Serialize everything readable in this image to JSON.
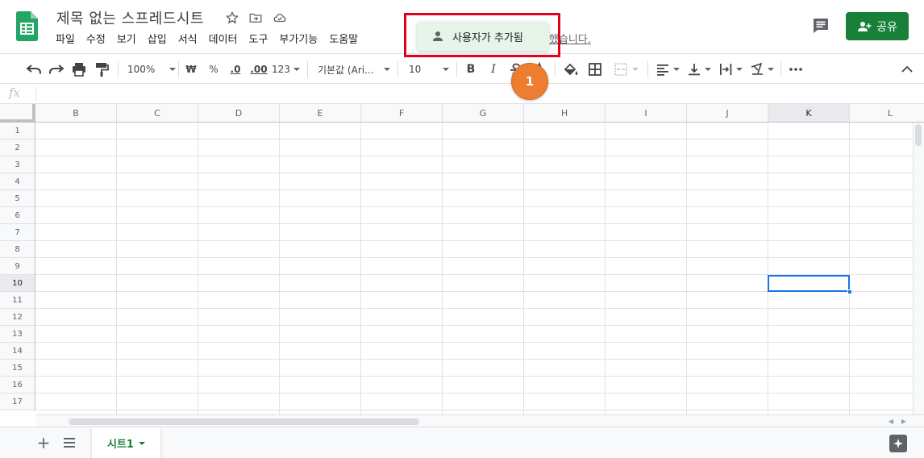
{
  "header": {
    "title": "제목 없는 스프레드시트",
    "menu": [
      "파일",
      "수정",
      "보기",
      "삽입",
      "서식",
      "데이터",
      "도구",
      "부가기능",
      "도움말"
    ],
    "last_edit": "했습니다.",
    "share_label": "공유"
  },
  "toast": {
    "label": "사용자가 추가됨",
    "step_number": "1"
  },
  "toolbar": {
    "zoom": "100%",
    "currency": "₩",
    "percent": "%",
    "decimal_decrease": ".0",
    "decimal_increase": ".00",
    "more_formats": "123",
    "font": "기본값 (Ari...",
    "font_size": "10",
    "bold": "B",
    "italic": "I"
  },
  "formula_bar": {
    "fx_label": "fx"
  },
  "grid": {
    "columns": [
      "B",
      "C",
      "D",
      "E",
      "F",
      "G",
      "H",
      "I",
      "J",
      "K",
      "L"
    ],
    "rows": [
      "1",
      "2",
      "3",
      "4",
      "5",
      "6",
      "7",
      "8",
      "9",
      "10",
      "11",
      "12",
      "13",
      "14",
      "15",
      "16",
      "17"
    ],
    "active_column": "K",
    "active_row": "10"
  },
  "sheets": {
    "tabs": [
      "시트1"
    ]
  },
  "colors": {
    "share": "#188038",
    "selection": "#1a73e8",
    "highlight_box": "#e2001a",
    "badge": "#ed7d31",
    "toast_bg": "#e6f4ea"
  }
}
